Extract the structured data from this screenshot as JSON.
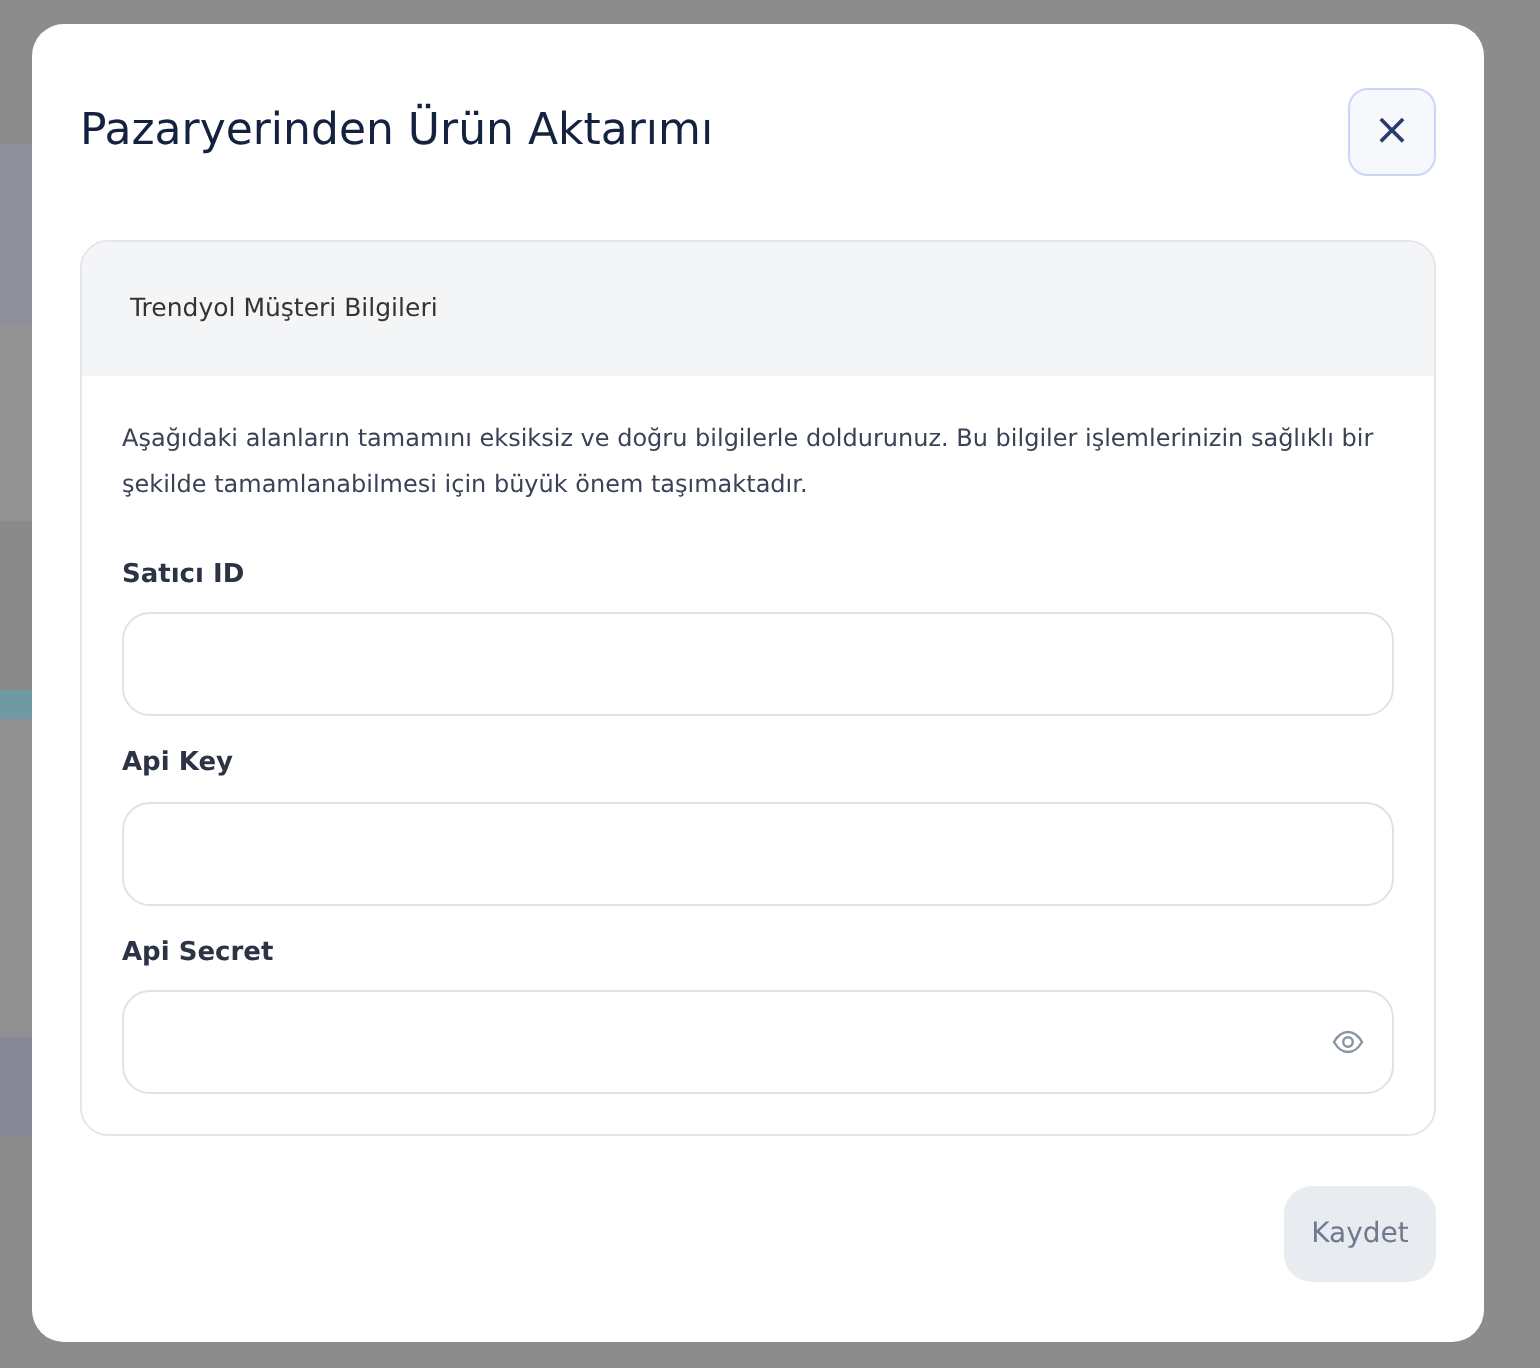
{
  "modal": {
    "title": "Pazaryerinden Ürün Aktarımı",
    "close": "×",
    "card": {
      "header": "Trendyol Müşteri Bilgileri",
      "intro": "Aşağıdaki alanların tamamını eksiksiz ve doğru bilgilerle doldurunuz. Bu bilgiler işlemlerinizin sağlıklı bir şekilde tamamlanabilmesi için büyük önem taşımaktadır.",
      "fields": [
        {
          "label": "Satıcı ID",
          "kind": "text"
        },
        {
          "label": "Api Key",
          "kind": "text"
        },
        {
          "label": "Api Secret",
          "kind": "password"
        }
      ]
    },
    "buttons": [
      {
        "label": "Kaydet",
        "disabled": true
      }
    ]
  }
}
